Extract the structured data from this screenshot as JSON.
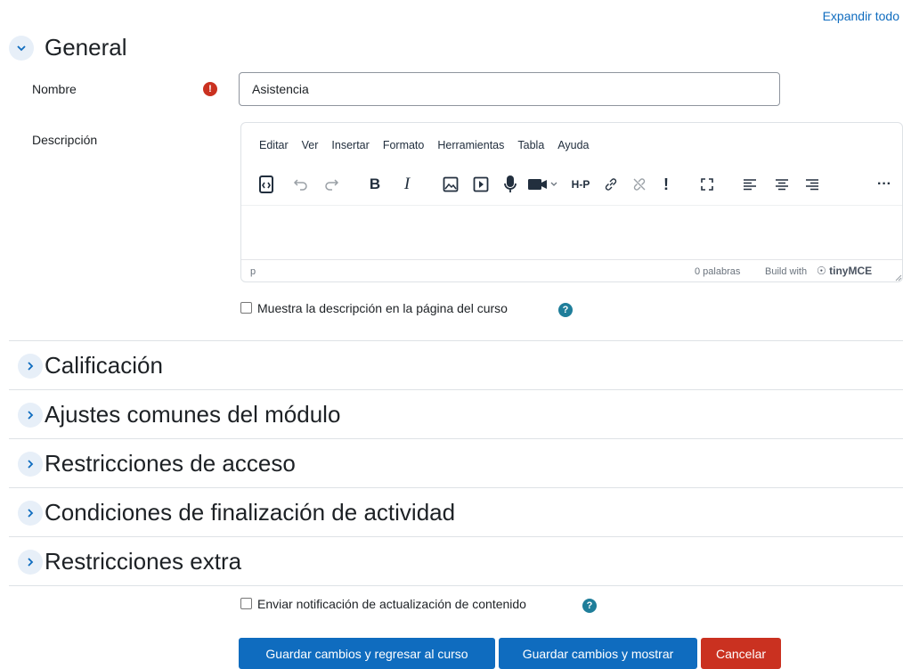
{
  "header": {
    "expand_all": "Expandir todo"
  },
  "general": {
    "title": "General",
    "name_label": "Nombre",
    "name_value": "Asistencia",
    "description_label": "Descripción",
    "editor": {
      "menu": [
        "Editar",
        "Ver",
        "Insertar",
        "Formato",
        "Herramientas",
        "Tabla",
        "Ayuda"
      ],
      "path": "p",
      "word_count": "0 palabras",
      "build": "Build with",
      "brand": "tinyMCE",
      "toolbar_icons": [
        "source-code-icon",
        "undo-icon",
        "redo-icon",
        "bold-icon",
        "italic-icon",
        "image-icon",
        "media-icon",
        "record-audio-icon",
        "record-video-icon",
        "h5p-icon",
        "link-icon",
        "unlink-icon",
        "exclamation-icon",
        "fullscreen-icon",
        "align-left-icon",
        "align-center-icon",
        "align-right-icon",
        "more-icon"
      ]
    },
    "show_description_label": "Muestra la descripción en la página del curso"
  },
  "sections": [
    {
      "title": "Calificación"
    },
    {
      "title": "Ajustes comunes del módulo"
    },
    {
      "title": "Restricciones de acceso"
    },
    {
      "title": "Condiciones de finalización de actividad"
    },
    {
      "title": "Restricciones extra"
    }
  ],
  "notify_label": "Enviar notificación de actualización de contenido",
  "buttons": {
    "save_return": "Guardar cambios y regresar al curso",
    "save_display": "Guardar cambios y mostrar",
    "cancel": "Cancelar"
  },
  "colors": {
    "primary": "#0f6cbf",
    "danger": "#ca3120",
    "help": "#1f7e9a"
  }
}
